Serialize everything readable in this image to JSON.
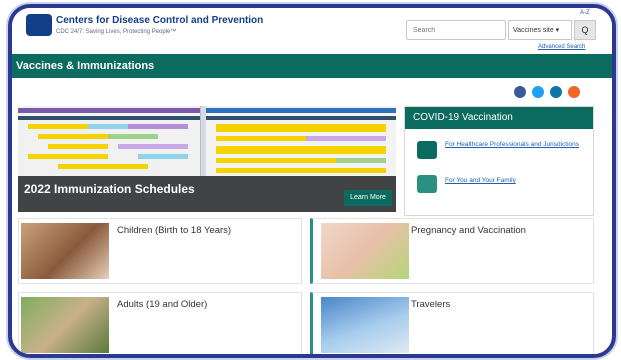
{
  "header": {
    "org_title": "Centers for Disease Control and Prevention",
    "org_subtitle": "CDC 24/7: Saving Lives, Protecting People™",
    "a_z": "A-Z",
    "search_placeholder": "Search",
    "search_scope": "Vaccines site ▾",
    "search_button": "Q",
    "advanced_search": "Advanced Search"
  },
  "nav": {
    "title": "Vaccines & Immunizations"
  },
  "social": [
    {
      "icon": "facebook-icon",
      "color": "#3b5998"
    },
    {
      "icon": "twitter-icon",
      "color": "#1da1f2"
    },
    {
      "icon": "linkedin-icon",
      "color": "#0e76a8"
    },
    {
      "icon": "syndicate-icon",
      "color": "#f26522"
    }
  ],
  "schedule": {
    "title": "2022 Immunization Schedules",
    "learn_more": "Learn More"
  },
  "covid": {
    "title": "COVID-19 Vaccination",
    "link1": "For Healthcare Professionals and Jurisdictions",
    "link2": "For You and Your Family"
  },
  "cards": [
    {
      "label": "Children (Birth to 18 Years)"
    },
    {
      "label": "Pregnancy and Vaccination"
    },
    {
      "label": "Adults (19 and Older)"
    },
    {
      "label": "Travelers"
    }
  ],
  "colors": {
    "brand_green": "#0b6b5f",
    "brand_blue": "#123f87",
    "frame": "#2b3a8f"
  }
}
